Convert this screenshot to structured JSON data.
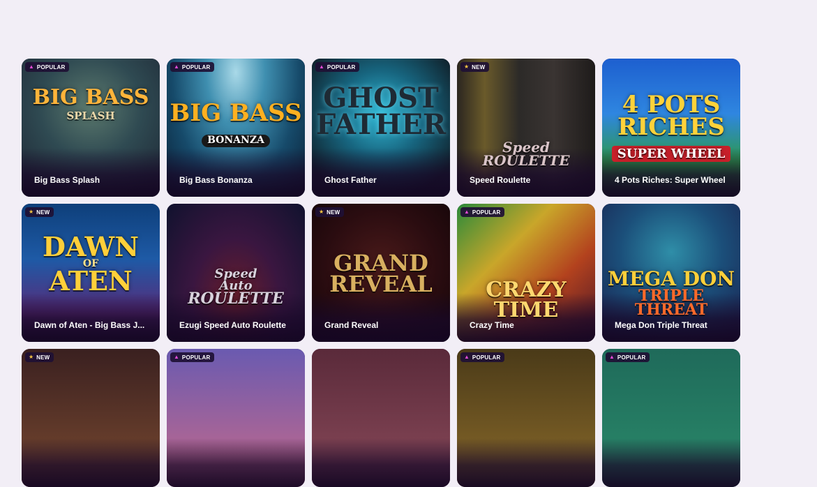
{
  "games": [
    {
      "name": "Big Bass Splash",
      "badge": {
        "label": "POPULAR",
        "icon": "flame-icon"
      },
      "art": [
        "BIG BASS",
        "SPLASH"
      ],
      "bg": "bg-splash",
      "t": "t-splash"
    },
    {
      "name": "Big Bass Bonanza",
      "badge": {
        "label": "POPULAR",
        "icon": "flame-icon"
      },
      "art": [
        "BIG BASS",
        "BONANZA"
      ],
      "bg": "bg-bonanza",
      "t": "t-bonanza"
    },
    {
      "name": "Ghost Father",
      "badge": {
        "label": "POPULAR",
        "icon": "flame-icon"
      },
      "art": [
        "GHOST",
        "FATHER"
      ],
      "bg": "bg-ghost",
      "t": "t-ghost"
    },
    {
      "name": "Speed Roulette",
      "badge": {
        "label": "NEW",
        "icon": "star-icon"
      },
      "art": [
        "Speed",
        "ROULETTE"
      ],
      "bg": "bg-speed",
      "t": "t-speed"
    },
    {
      "name": "4 Pots Riches: Super Wheel",
      "badge": null,
      "art": [
        "4 POTS RICHES",
        "SUPER WHEEL"
      ],
      "bg": "bg-pots",
      "t": "t-pots"
    },
    {
      "name": "Dawn of Aten - Big Bass J...",
      "badge": {
        "label": "NEW",
        "icon": "star-icon"
      },
      "art": [
        "DAWN",
        "OF",
        "ATEN"
      ],
      "bg": "bg-aten",
      "t": "t-aten"
    },
    {
      "name": "Ezugi Speed Auto Roulette",
      "badge": null,
      "art": [
        "Speed",
        "Auto",
        "ROULETTE"
      ],
      "bg": "bg-ezugi",
      "t": "t-ezugi"
    },
    {
      "name": "Grand Reveal",
      "badge": {
        "label": "NEW",
        "icon": "star-icon"
      },
      "art": [
        "GRAND",
        "REVEAL"
      ],
      "bg": "bg-grand",
      "t": "t-grand"
    },
    {
      "name": "Crazy Time",
      "badge": {
        "label": "POPULAR",
        "icon": "flame-icon"
      },
      "art": [
        "CRAZY",
        "TIME"
      ],
      "bg": "bg-crazy",
      "t": "t-crazy"
    },
    {
      "name": "Mega Don Triple Threat",
      "badge": null,
      "art": [
        "MEGA DON",
        "TRIPLE THREAT"
      ],
      "bg": "bg-mega",
      "t": "t-mega"
    },
    {
      "name": "",
      "badge": {
        "label": "NEW",
        "icon": "star-icon"
      },
      "art": [],
      "bg": "bg-r3a",
      "t": ""
    },
    {
      "name": "",
      "badge": {
        "label": "POPULAR",
        "icon": "flame-icon"
      },
      "art": [],
      "bg": "bg-r3b",
      "t": ""
    },
    {
      "name": "",
      "badge": null,
      "art": [],
      "bg": "bg-r3c",
      "t": ""
    },
    {
      "name": "",
      "badge": {
        "label": "POPULAR",
        "icon": "flame-icon"
      },
      "art": [],
      "bg": "bg-r3d",
      "t": ""
    },
    {
      "name": "",
      "badge": {
        "label": "POPULAR",
        "icon": "flame-icon"
      },
      "art": [],
      "bg": "bg-r3e",
      "t": ""
    }
  ]
}
